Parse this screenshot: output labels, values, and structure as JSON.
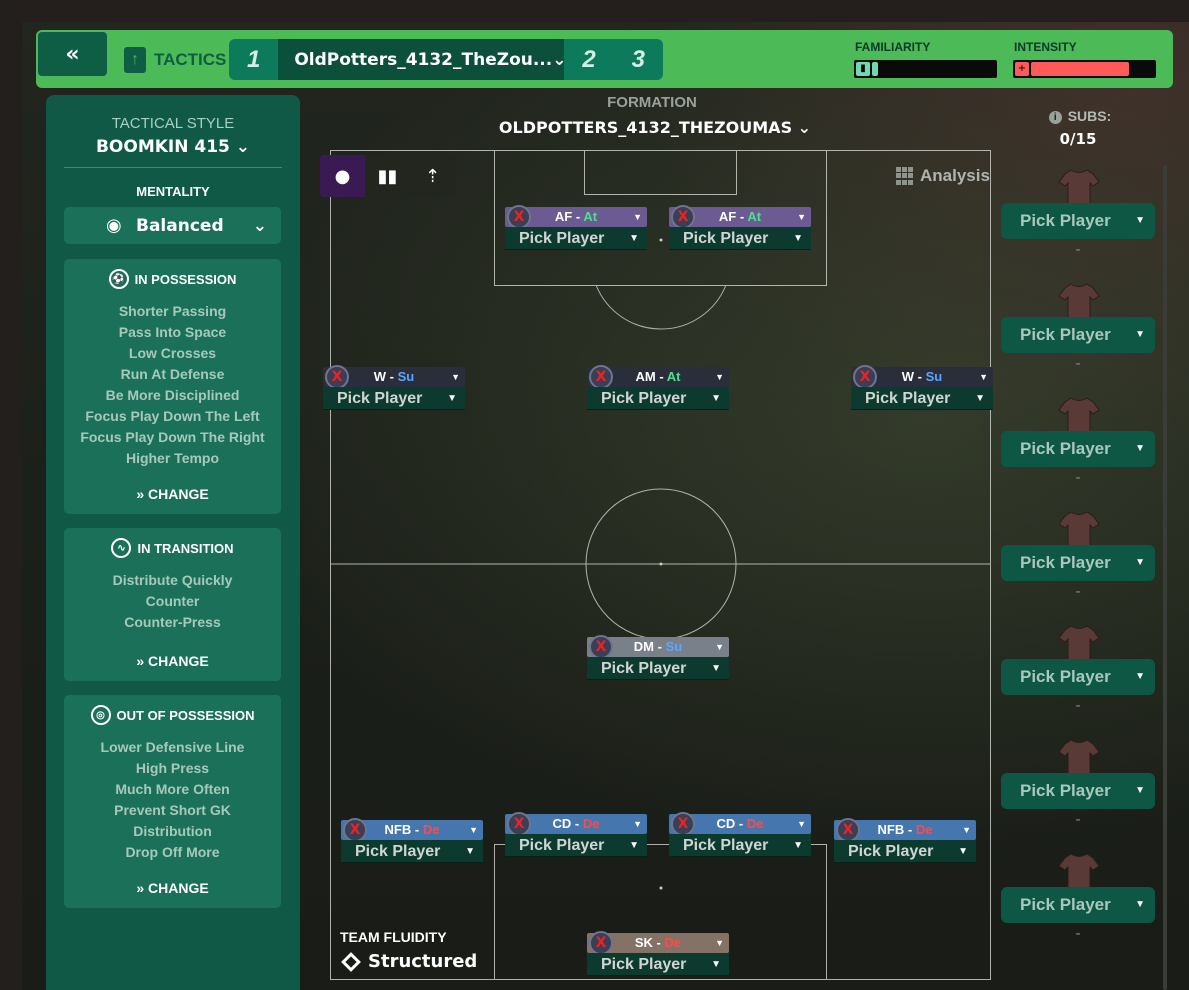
{
  "topbar": {
    "tactics_label": "TACTICS",
    "tabs": [
      "1",
      "2",
      "3"
    ],
    "active_tactic": "OldPotters_4132_TheZou...",
    "familiarity_label": "FAMILIARITY",
    "intensity_label": "INTENSITY",
    "familiarity_level": 0.03,
    "intensity_level": 0.8
  },
  "sidebar": {
    "tactical_style_label": "TACTICAL STYLE",
    "tactical_style_value": "BOOMKIN 415",
    "mentality_label": "MENTALITY",
    "mentality_value": "Balanced",
    "in_possession": {
      "title": "IN POSSESSION",
      "items": [
        "Shorter Passing",
        "Pass Into Space",
        "Low Crosses",
        "Run At Defense",
        "Be More Disciplined",
        "Focus Play Down The Left",
        "Focus Play Down The Right",
        "Higher Tempo"
      ],
      "change": "CHANGE"
    },
    "in_transition": {
      "title": "IN TRANSITION",
      "items": [
        "Distribute Quickly",
        "Counter",
        "Counter-Press"
      ],
      "change": "CHANGE"
    },
    "out_of_possession": {
      "title": "OUT OF POSSESSION",
      "items": [
        "Lower Defensive Line",
        "High Press",
        "Much More Often",
        "Prevent Short GK",
        "Distribution",
        "Drop Off More"
      ],
      "change": "CHANGE"
    }
  },
  "formation": {
    "label": "FORMATION",
    "name": "OLDPOTTERS_4132_THEZOUMAS",
    "analysis": "Analysis",
    "pick_label": "Pick Player",
    "slots": [
      {
        "role": "AF",
        "duty": "At",
        "color": "#6b5b92"
      },
      {
        "role": "AF",
        "duty": "At",
        "color": "#6b5b92"
      },
      {
        "role": "W",
        "duty": "Su",
        "color": "#2a2e3b"
      },
      {
        "role": "AM",
        "duty": "At",
        "color": "#2a2e3b"
      },
      {
        "role": "W",
        "duty": "Su",
        "color": "#2a2e3b"
      },
      {
        "role": "DM",
        "duty": "Su",
        "color": "#7a808a"
      },
      {
        "role": "NFB",
        "duty": "De",
        "color": "#4577ae"
      },
      {
        "role": "CD",
        "duty": "De",
        "color": "#4577ae"
      },
      {
        "role": "CD",
        "duty": "De",
        "color": "#4577ae"
      },
      {
        "role": "NFB",
        "duty": "De",
        "color": "#4577ae"
      },
      {
        "role": "SK",
        "duty": "De",
        "color": "#857266"
      }
    ],
    "fluidity_label": "TEAM FLUIDITY",
    "fluidity_value": "Structured"
  },
  "subs": {
    "label": "SUBS:",
    "count": "0/15",
    "pick_label": "Pick Player",
    "dash": "-",
    "visible_count": 7
  },
  "colors": {
    "accent": "#4cba56",
    "sidebar": "#0f5946",
    "duty_attack": "#4ee08a",
    "duty_support": "#5aa7ff",
    "duty_defend": "#ff4a4a"
  }
}
